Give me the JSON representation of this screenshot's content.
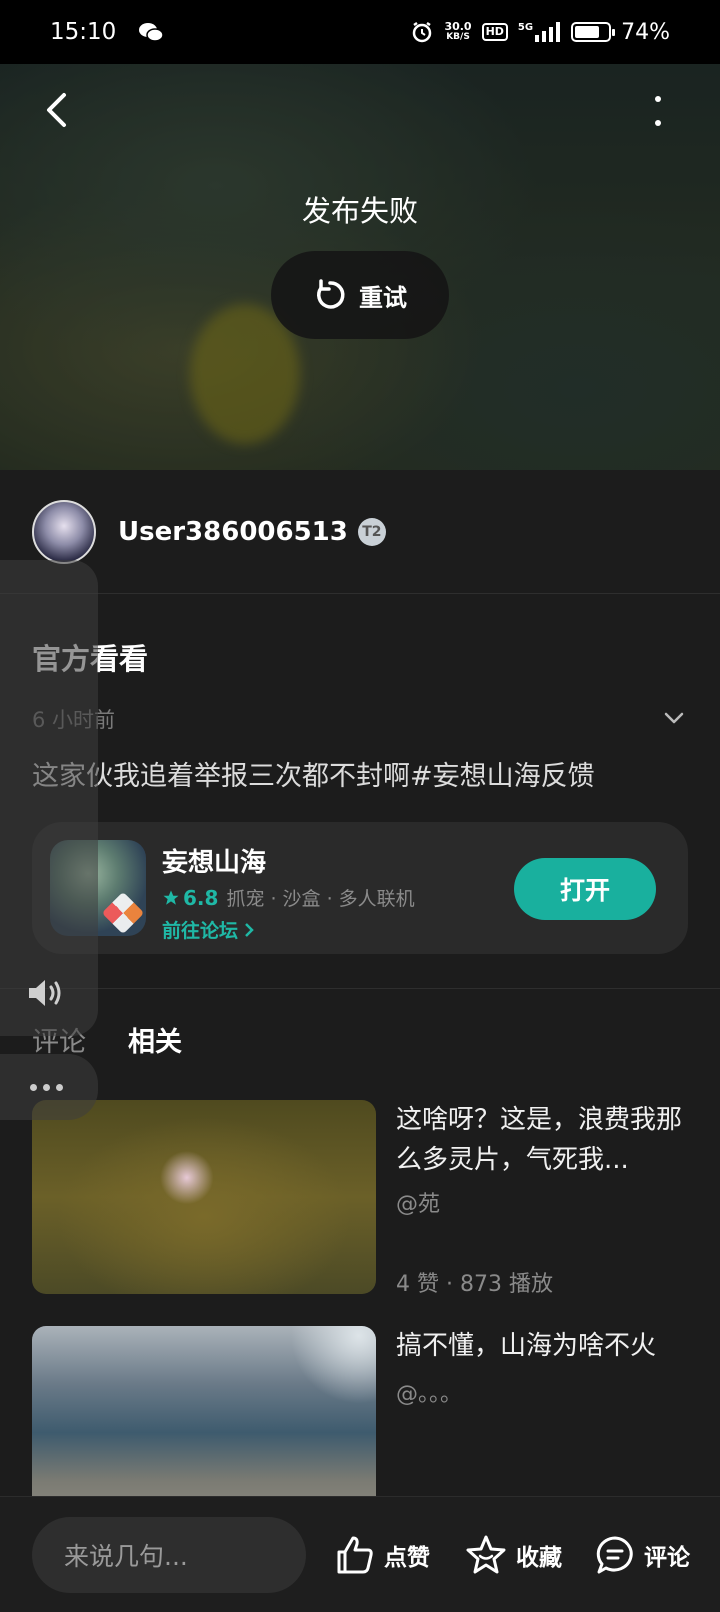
{
  "status_bar": {
    "time": "15:10",
    "network_speed": "30.0",
    "network_unit": "KB/S",
    "hd_label": "HD",
    "network_type": "5G",
    "battery": "74%",
    "battery_level": 0.74
  },
  "video": {
    "status_text": "发布失败",
    "retry_label": "重试"
  },
  "author": {
    "username": "User386006513",
    "level": "T2"
  },
  "post": {
    "title": "官方看看",
    "time": "6 小时前",
    "body": "这家伙我追着举报三次都不封啊#妄想山海反馈"
  },
  "game_card": {
    "name": "妄想山海",
    "score": "6.8",
    "tags": "抓宠 · 沙盒 · 多人联机",
    "forum_link": "前往论坛",
    "open_label": "打开",
    "accent_color": "#19b09e"
  },
  "tabs": [
    {
      "label": "评论",
      "active": false
    },
    {
      "label": "相关",
      "active": true
    }
  ],
  "related": [
    {
      "title": "这啥呀？这是，浪费我那么多灵片，气死我...",
      "author": "@苑",
      "stats": "4 赞 · 873 播放"
    },
    {
      "title": "搞不懂，山海为啥不火",
      "author": "@。。。",
      "stats": ""
    }
  ],
  "bottom_bar": {
    "input_placeholder": "来说几句...",
    "like_label": "点赞",
    "favorite_label": "收藏",
    "comment_label": "评论"
  }
}
